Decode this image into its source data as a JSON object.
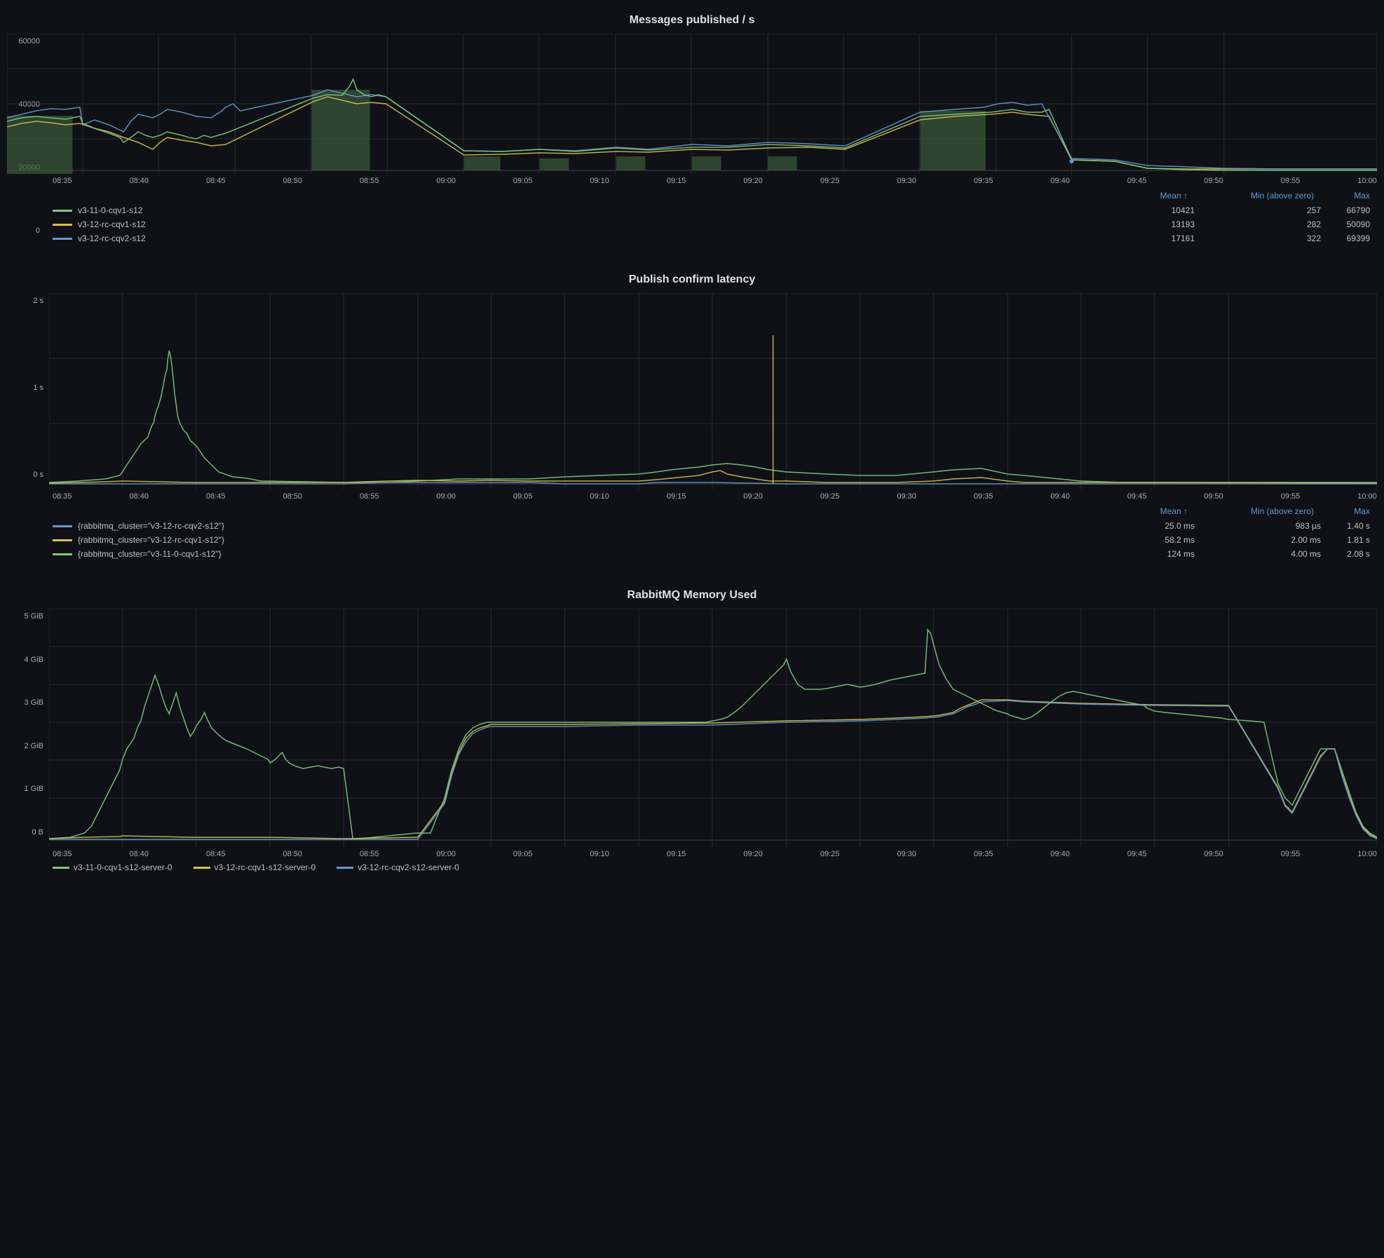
{
  "charts": {
    "messages_published": {
      "title": "Messages published / s",
      "y_axis": [
        "60000",
        "40000",
        "20000",
        "0"
      ],
      "x_axis": [
        "08:35",
        "08:40",
        "08:45",
        "08:50",
        "08:55",
        "09:00",
        "09:05",
        "09:10",
        "09:15",
        "09:20",
        "09:25",
        "09:30",
        "09:35",
        "09:40",
        "09:45",
        "09:50",
        "09:55",
        "10:00"
      ],
      "legend_headers": {
        "mean": "Mean ↑",
        "min": "Min (above zero)",
        "max": "Max"
      },
      "series": [
        {
          "name": "v3-11-0-cqv1-s12",
          "color": "#7ec87e",
          "mean": "10421",
          "min": "257",
          "max": "66790"
        },
        {
          "name": "v3-12-rc-cqv1-s12",
          "color": "#d4c050",
          "mean": "13193",
          "min": "282",
          "max": "50090"
        },
        {
          "name": "v3-12-rc-cqv2-s12",
          "color": "#6699cc",
          "mean": "17161",
          "min": "322",
          "max": "69399"
        }
      ]
    },
    "publish_confirm_latency": {
      "title": "Publish confirm latency",
      "y_axis": [
        "2 s",
        "1 s",
        "0 s"
      ],
      "x_axis": [
        "08:35",
        "08:40",
        "08:45",
        "08:50",
        "08:55",
        "09:00",
        "09:05",
        "09:10",
        "09:15",
        "09:20",
        "09:25",
        "09:30",
        "09:35",
        "09:40",
        "09:45",
        "09:50",
        "09:55",
        "10:00"
      ],
      "legend_headers": {
        "mean": "Mean ↑",
        "min": "Min (above zero)",
        "max": "Max"
      },
      "series": [
        {
          "name": "{rabbitmq_cluster=\"v3-12-rc-cqv2-s12\"}",
          "color": "#6699cc",
          "mean": "25.0 ms",
          "min": "983 µs",
          "max": "1.40 s"
        },
        {
          "name": "{rabbitmq_cluster=\"v3-12-rc-cqv1-s12\"}",
          "color": "#d4c050",
          "mean": "58.2 ms",
          "min": "2.00 ms",
          "max": "1.81 s"
        },
        {
          "name": "{rabbitmq_cluster=\"v3-11-0-cqv1-s12\"}",
          "color": "#7ec87e",
          "mean": "124 ms",
          "min": "4.00 ms",
          "max": "2.08 s"
        }
      ]
    },
    "rabbitmq_memory": {
      "title": "RabbitMQ Memory Used",
      "y_axis": [
        "5 GiB",
        "4 GiB",
        "3 GiB",
        "2 GiB",
        "1 GiB",
        "0 B"
      ],
      "x_axis": [
        "08:35",
        "08:40",
        "08:45",
        "08:50",
        "08:55",
        "09:00",
        "09:05",
        "09:10",
        "09:15",
        "09:20",
        "09:25",
        "09:30",
        "09:35",
        "09:40",
        "09:45",
        "09:50",
        "09:55",
        "10:00"
      ],
      "legend": [
        {
          "name": "v3-11-0-cqv1-s12-server-0",
          "color": "#7ec87e"
        },
        {
          "name": "v3-12-rc-cqv1-s12-server-0",
          "color": "#d4c050"
        },
        {
          "name": "v3-12-rc-cqv2-s12-server-0",
          "color": "#6699cc"
        }
      ]
    }
  }
}
